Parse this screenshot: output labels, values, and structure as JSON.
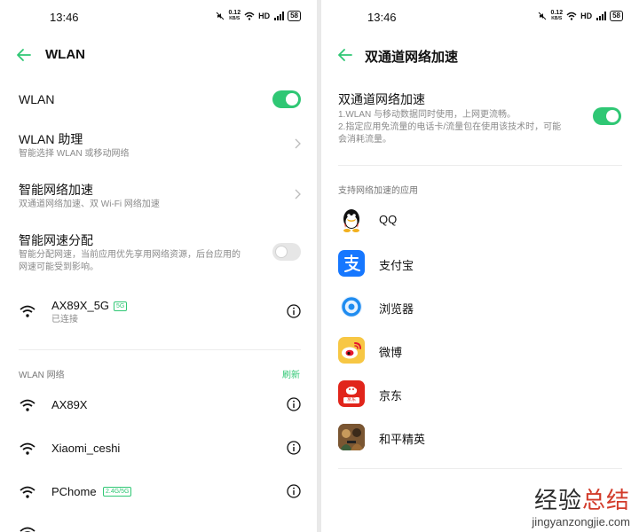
{
  "left": {
    "status": {
      "time": "13:46",
      "speed": "0.12",
      "speed_unit": "KB/S",
      "hd": "HD",
      "battery": "58"
    },
    "header": {
      "title": "WLAN"
    },
    "wlan_toggle": {
      "label": "WLAN",
      "state": "on"
    },
    "assistant": {
      "title": "WLAN 助理",
      "subtitle": "智能选择 WLAN 或移动网络"
    },
    "smart_accel": {
      "title": "智能网络加速",
      "subtitle": "双通道网络加速、双 Wi-Fi 网络加速"
    },
    "smart_alloc": {
      "title": "智能网速分配",
      "subtitle_line1": "智能分配网速，当前应用优先享用网络资源，后台应用的",
      "subtitle_line2": "网速可能受到影响。",
      "state": "off"
    },
    "connected": {
      "name": "AX89X_5G",
      "tag": "5G",
      "status": "已连接"
    },
    "networks_section": {
      "label": "WLAN 网络",
      "refresh": "刷新"
    },
    "networks": [
      {
        "name": "AX89X",
        "tag": ""
      },
      {
        "name": "Xiaomi_ceshi",
        "tag": ""
      },
      {
        "name": "PChome",
        "tag": "2.4G/5G"
      }
    ]
  },
  "right": {
    "status": {
      "time": "13:46",
      "speed": "0.12",
      "speed_unit": "KB/S",
      "hd": "HD",
      "battery": "58"
    },
    "header": {
      "title": "双通道网络加速"
    },
    "dual_channel": {
      "title": "双通道网络加速",
      "desc1": "1.WLAN 与移动数据同时使用，上网更流畅。",
      "desc2": "2.指定应用免流量的电话卡/流量包在使用该技术时，可能",
      "desc3": "会消耗流量。",
      "state": "on"
    },
    "apps_section": {
      "label": "支持网络加速的应用"
    },
    "apps": [
      {
        "name": "QQ",
        "icon": "qq-icon"
      },
      {
        "name": "支付宝",
        "icon": "alipay-icon"
      },
      {
        "name": "浏览器",
        "icon": "browser-icon"
      },
      {
        "name": "微博",
        "icon": "weibo-icon"
      },
      {
        "name": "京东",
        "icon": "jd-icon",
        "icon_text": "京东"
      },
      {
        "name": "和平精英",
        "icon": "game-icon"
      }
    ]
  },
  "watermark": {
    "cn_a": "经验",
    "cn_b": "总结",
    "en": "jingyanzongjie.com"
  },
  "colors": {
    "accent": "#2fc774",
    "background": "#ffffff",
    "divider": "#ececec"
  }
}
